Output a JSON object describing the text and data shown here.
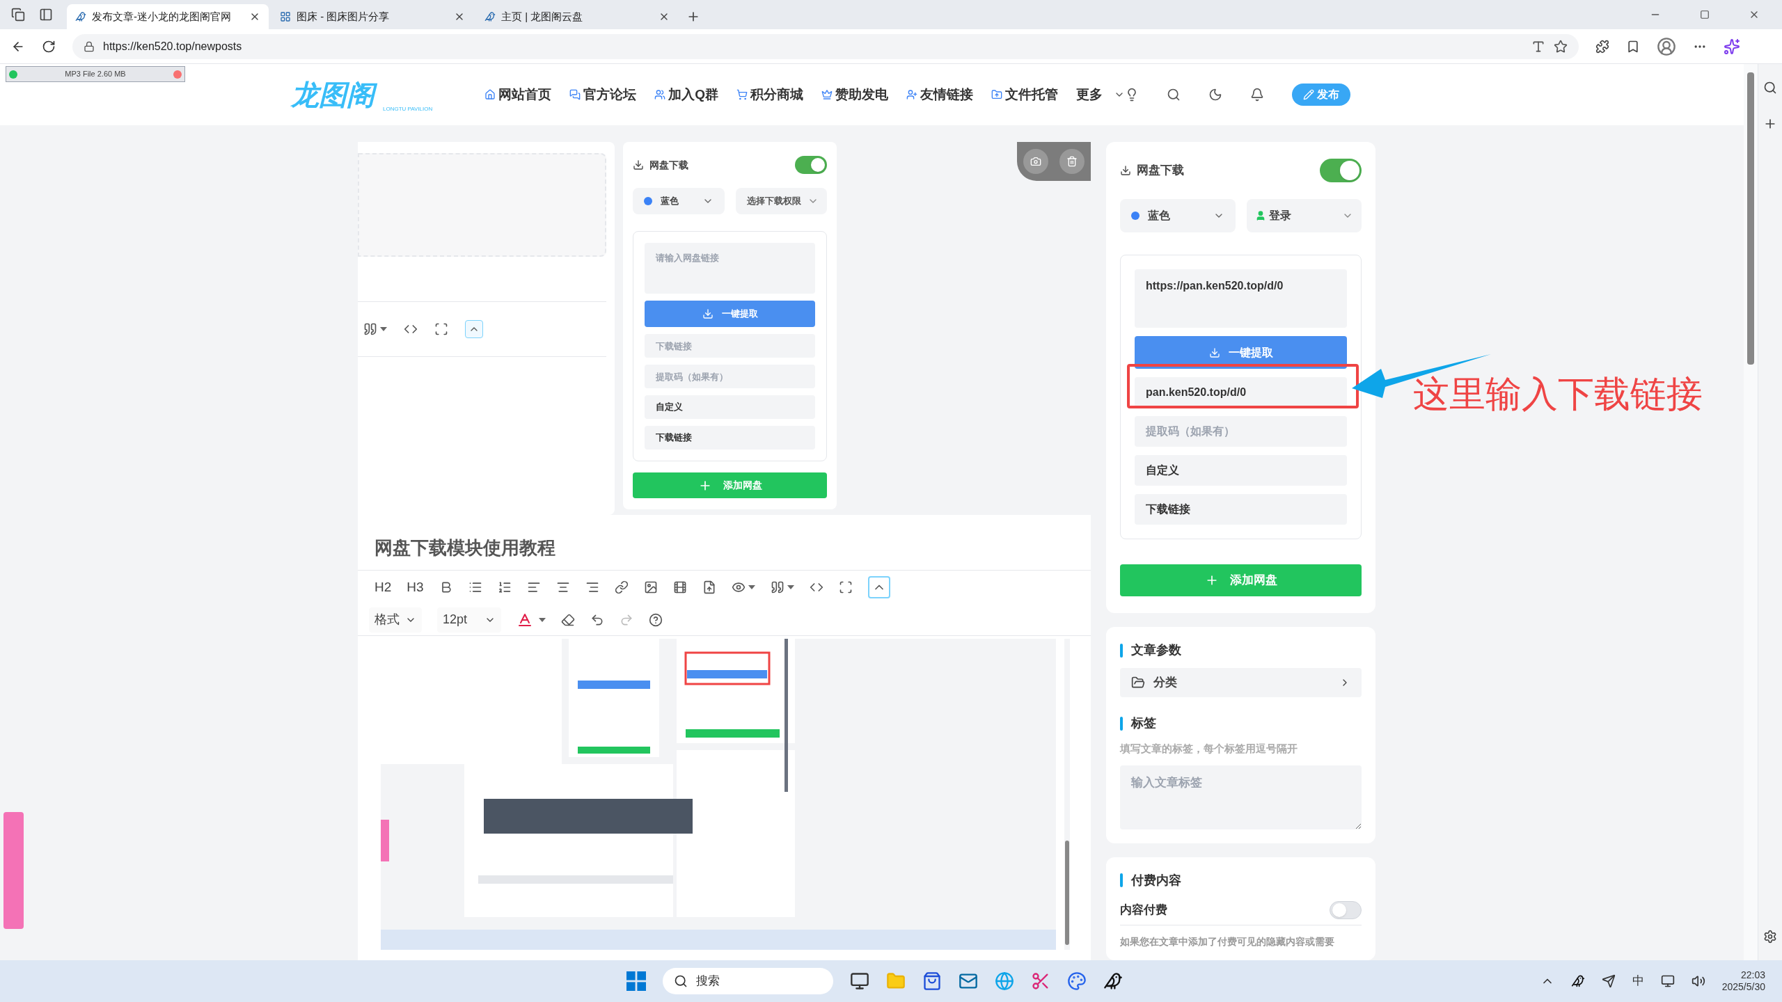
{
  "browser": {
    "tabs": [
      {
        "title": "发布文章-迷小龙的龙图阁官网",
        "selected": true
      },
      {
        "title": "图床 - 图床图片分享",
        "selected": false
      },
      {
        "title": "主页 | 龙图阁云盘",
        "selected": false
      }
    ],
    "url": "https://ken520.top/newposts"
  },
  "download_bar": {
    "label": "MP3 File 2.60 MB"
  },
  "site_header": {
    "logo": "龙图阁",
    "logo_sub": "LONGTU PAVILION",
    "nav": [
      "网站首页",
      "官方论坛",
      "加入Q群",
      "积分商城",
      "赞助发电",
      "友情链接",
      "文件托管",
      "更多"
    ],
    "publish": "发布"
  },
  "pasted_module": {
    "title": "网盘下载",
    "enabled": true,
    "color": {
      "label": "蓝色",
      "color": "#3b82f6"
    },
    "permission": {
      "label": "选择下载权限",
      "kind": "placeholder"
    },
    "link_field": {
      "placeholder": "请输入网盘链接"
    },
    "extract_button": "一键提取",
    "fields": [
      {
        "placeholder": "下载链接"
      },
      {
        "placeholder": "提取码（如果有）"
      },
      {
        "value": "自定义"
      },
      {
        "value": "下载链接"
      }
    ],
    "add_button": "添加网盘"
  },
  "pasted_toolbar": {
    "collapse_active": true
  },
  "editor": {
    "title": "网盘下载模块使用教程",
    "headings": [
      "H2",
      "H3"
    ],
    "format_select": "格式",
    "size_select": "12pt",
    "collapse_active": true,
    "content_image": {
      "kind": "picture"
    }
  },
  "module": {
    "title": "网盘下载",
    "enabled": true,
    "color": {
      "label": "蓝色",
      "color": "#3b82f6"
    },
    "permission": {
      "label": "登录",
      "kind": "role"
    },
    "link_field": {
      "value": "https://pan.ken520.top/d/0"
    },
    "extract_button": "一键提取",
    "fields": [
      {
        "value": "pan.ken520.top/d/0"
      },
      {
        "placeholder": "提取码（如果有）"
      },
      {
        "value": "自定义"
      },
      {
        "value": "下载链接"
      }
    ],
    "add_button": "添加网盘"
  },
  "annotation": {
    "text": "这里输入下载链接"
  },
  "article_params": {
    "heading": "文章参数",
    "category": "分类",
    "tags_heading": "标签",
    "tags_hint": "填写文章的标签，每个标签用逗号隔开",
    "tags_field": {
      "placeholder": "输入文章标签"
    }
  },
  "paid": {
    "heading": "付费内容",
    "toggle_label": "内容付费",
    "enabled": false,
    "note": "如果您在文章中添加了付费可见的隐藏内容或需要"
  },
  "taskbar": {
    "search": "搜索",
    "ime": "中",
    "time": "22:03",
    "date": "2025/5/30"
  }
}
